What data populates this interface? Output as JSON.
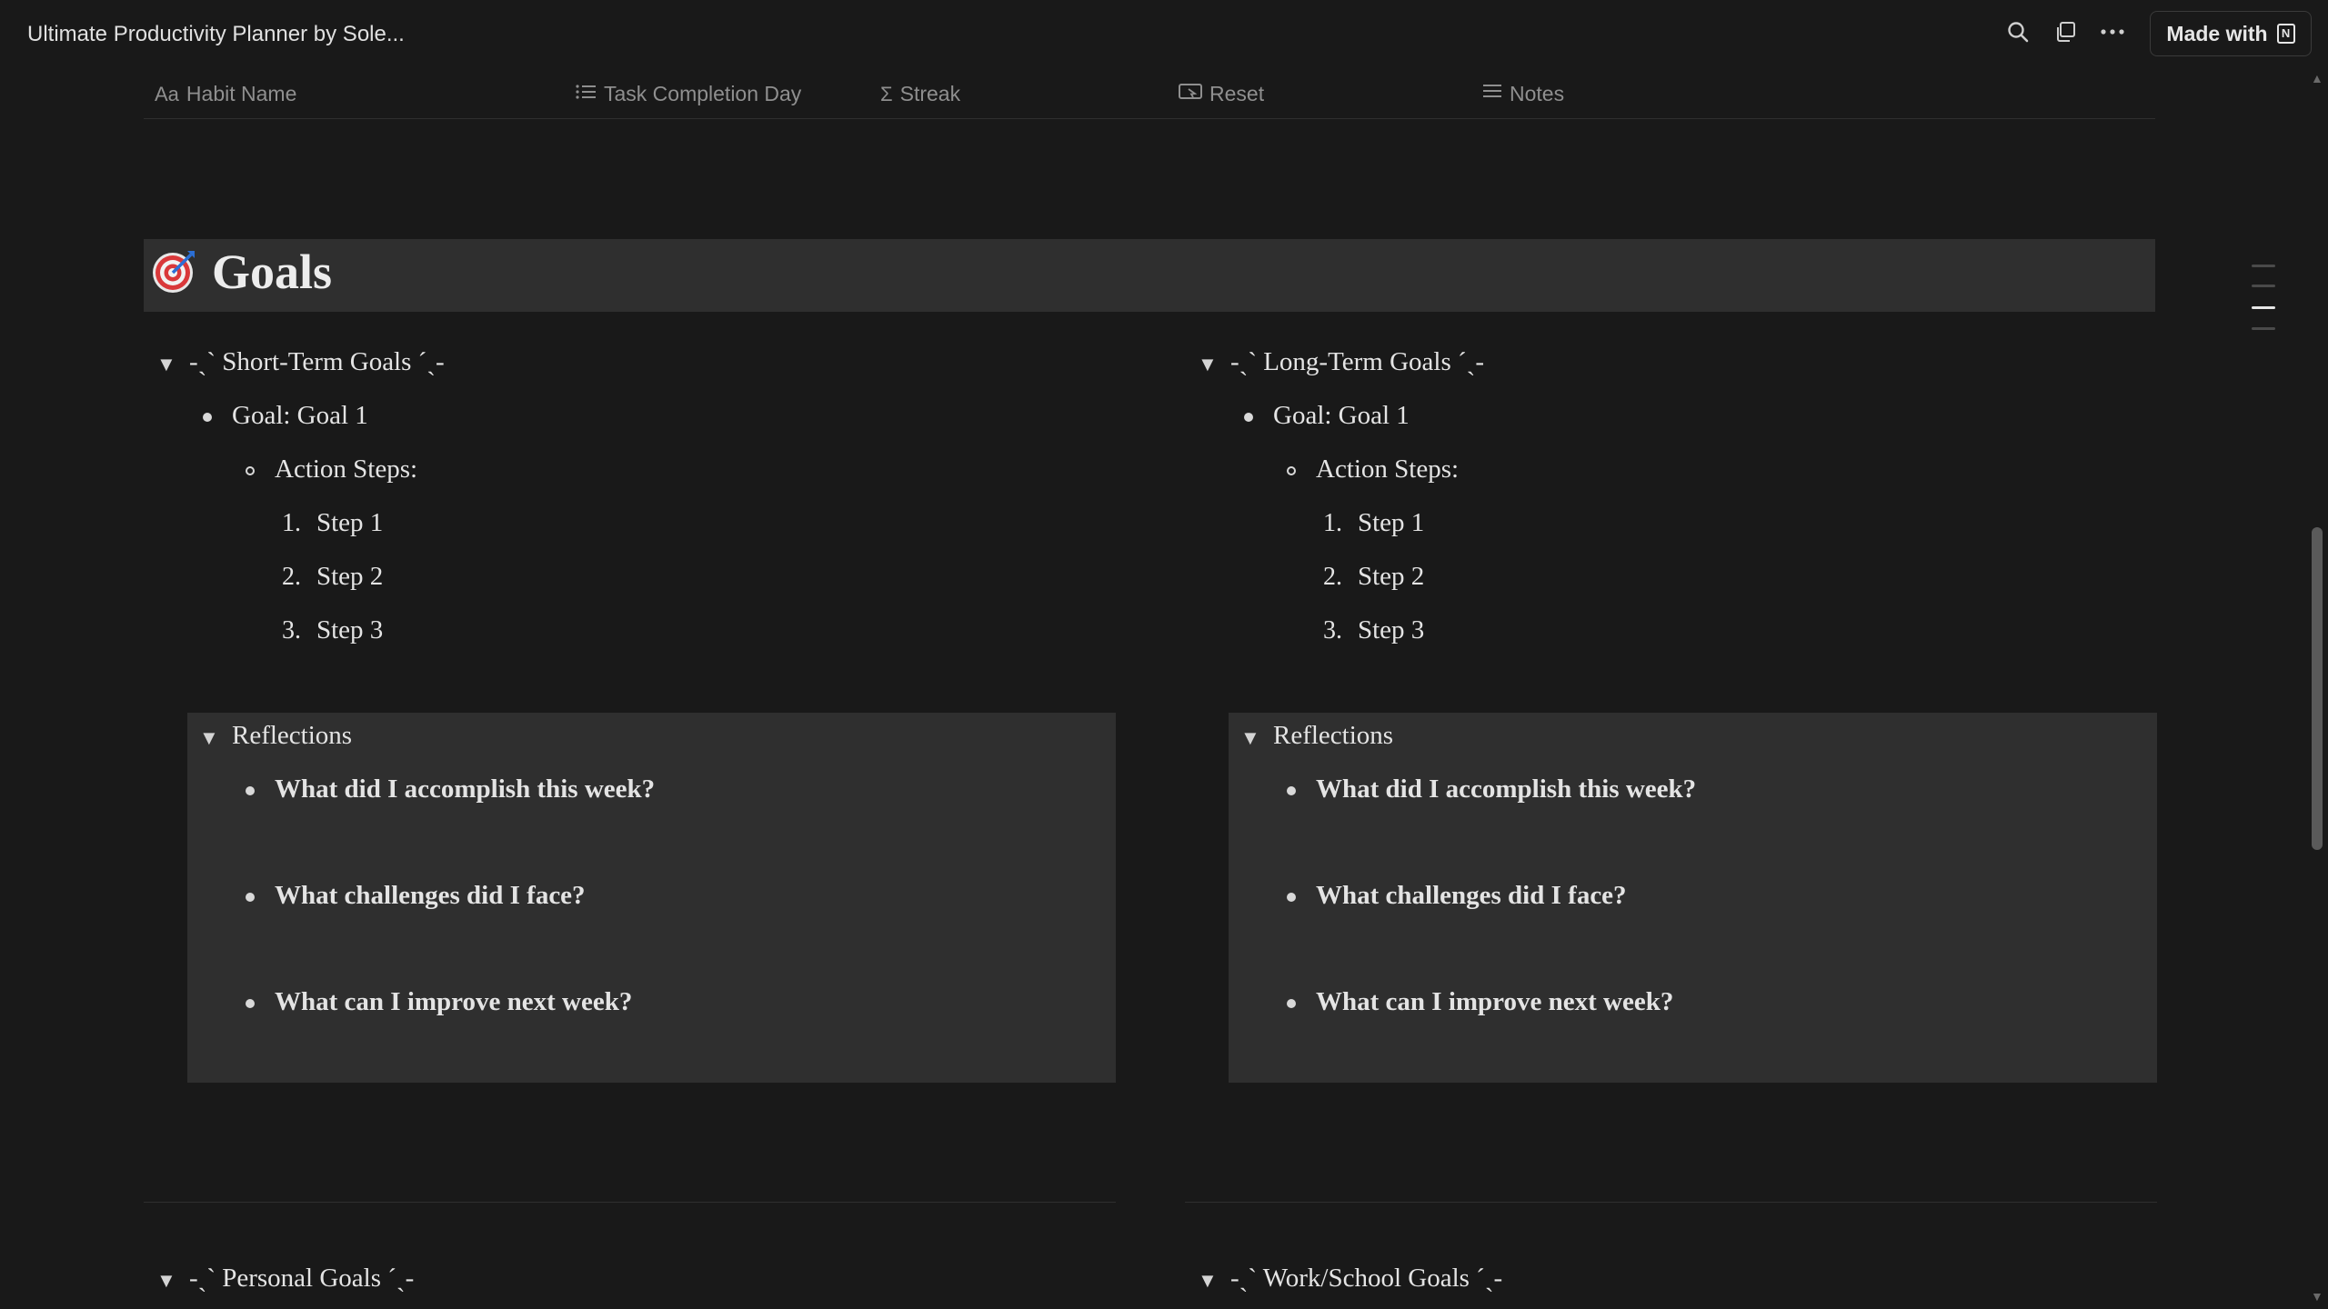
{
  "app": {
    "title": "Ultimate Productivity Planner by Sole...",
    "made_with_label": "Made with",
    "made_with_logo": "N"
  },
  "toolbar": {
    "icons": [
      "search-icon",
      "duplicate-icon",
      "more-icon"
    ]
  },
  "table_header": {
    "columns": [
      {
        "icon": "Aa",
        "label": "Habit Name"
      },
      {
        "icon": "list-icon",
        "label": "Task Completion Day"
      },
      {
        "icon": "Σ",
        "label": "Streak"
      },
      {
        "icon": "button-icon",
        "label": "Reset"
      },
      {
        "icon": "text-icon",
        "label": "Notes"
      }
    ]
  },
  "goals": {
    "title": "Goals",
    "icon": "target-icon",
    "columns": [
      {
        "toggle_title": "-ˏˋ Short-Term Goals ˊˎ-",
        "goal": "Goal: Goal 1",
        "action_steps_label": "Action Steps:",
        "steps": [
          {
            "n": "1.",
            "text": "Step 1"
          },
          {
            "n": "2.",
            "text": "Step 2"
          },
          {
            "n": "3.",
            "text": "Step 3"
          }
        ],
        "reflections": {
          "title": "Reflections",
          "questions": [
            "What did I accomplish this week?",
            "What challenges did I face?",
            "What can I improve next week?"
          ]
        }
      },
      {
        "toggle_title": "-ˏˋ Long-Term Goals ˊˎ-",
        "goal": "Goal: Goal 1",
        "action_steps_label": "Action Steps:",
        "steps": [
          {
            "n": "1.",
            "text": "Step 1"
          },
          {
            "n": "2.",
            "text": "Step 2"
          },
          {
            "n": "3.",
            "text": "Step 3"
          }
        ],
        "reflections": {
          "title": "Reflections",
          "questions": [
            "What did I accomplish this week?",
            "What challenges did I face?",
            "What can I improve next week?"
          ]
        }
      }
    ],
    "bottom_toggles": [
      "-ˏˋ Personal Goals ˊˎ-",
      "-ˏˋ Work/School Goals ˊˎ-"
    ]
  },
  "colors": {
    "background": "#191919",
    "band": "#2f2f2f",
    "text": "#e4e4e4",
    "muted": "#8f8f8f"
  }
}
